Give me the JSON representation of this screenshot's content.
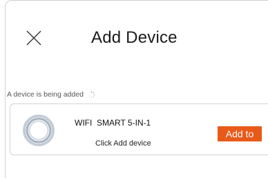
{
  "header": {
    "title": "Add Device",
    "close_icon": "close-icon"
  },
  "status": {
    "text": "A device is being added",
    "icon": "loading-spinner-icon"
  },
  "device": {
    "name": "WIFI  SMART 5-IN-1",
    "hint": "Click Add device",
    "image": "coiled-cable-device-image",
    "add_label": "Add to"
  },
  "colors": {
    "accent": "#e85a1a",
    "border": "#d2d2d2",
    "text": "#1a1a1a"
  }
}
